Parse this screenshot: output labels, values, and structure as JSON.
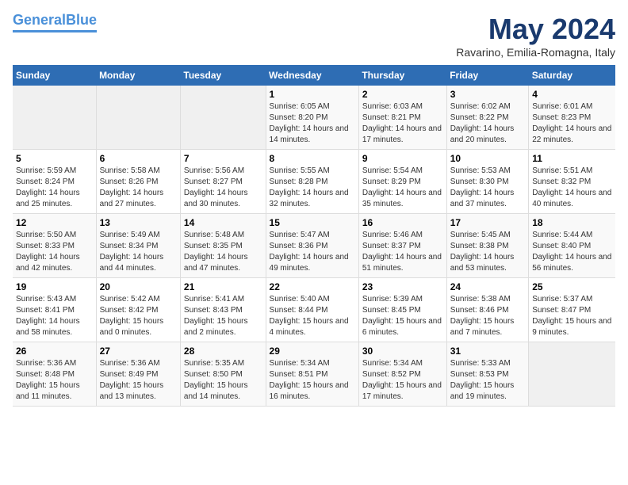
{
  "logo": {
    "line1": "General",
    "line2": "Blue"
  },
  "title": "May 2024",
  "subtitle": "Ravarino, Emilia-Romagna, Italy",
  "days_of_week": [
    "Sunday",
    "Monday",
    "Tuesday",
    "Wednesday",
    "Thursday",
    "Friday",
    "Saturday"
  ],
  "weeks": [
    [
      {
        "day": "",
        "empty": true
      },
      {
        "day": "",
        "empty": true
      },
      {
        "day": "",
        "empty": true
      },
      {
        "day": "1",
        "sunrise": "6:05 AM",
        "sunset": "8:20 PM",
        "daylight": "14 hours and 14 minutes."
      },
      {
        "day": "2",
        "sunrise": "6:03 AM",
        "sunset": "8:21 PM",
        "daylight": "14 hours and 17 minutes."
      },
      {
        "day": "3",
        "sunrise": "6:02 AM",
        "sunset": "8:22 PM",
        "daylight": "14 hours and 20 minutes."
      },
      {
        "day": "4",
        "sunrise": "6:01 AM",
        "sunset": "8:23 PM",
        "daylight": "14 hours and 22 minutes."
      }
    ],
    [
      {
        "day": "5",
        "sunrise": "5:59 AM",
        "sunset": "8:24 PM",
        "daylight": "14 hours and 25 minutes."
      },
      {
        "day": "6",
        "sunrise": "5:58 AM",
        "sunset": "8:26 PM",
        "daylight": "14 hours and 27 minutes."
      },
      {
        "day": "7",
        "sunrise": "5:56 AM",
        "sunset": "8:27 PM",
        "daylight": "14 hours and 30 minutes."
      },
      {
        "day": "8",
        "sunrise": "5:55 AM",
        "sunset": "8:28 PM",
        "daylight": "14 hours and 32 minutes."
      },
      {
        "day": "9",
        "sunrise": "5:54 AM",
        "sunset": "8:29 PM",
        "daylight": "14 hours and 35 minutes."
      },
      {
        "day": "10",
        "sunrise": "5:53 AM",
        "sunset": "8:30 PM",
        "daylight": "14 hours and 37 minutes."
      },
      {
        "day": "11",
        "sunrise": "5:51 AM",
        "sunset": "8:32 PM",
        "daylight": "14 hours and 40 minutes."
      }
    ],
    [
      {
        "day": "12",
        "sunrise": "5:50 AM",
        "sunset": "8:33 PM",
        "daylight": "14 hours and 42 minutes."
      },
      {
        "day": "13",
        "sunrise": "5:49 AM",
        "sunset": "8:34 PM",
        "daylight": "14 hours and 44 minutes."
      },
      {
        "day": "14",
        "sunrise": "5:48 AM",
        "sunset": "8:35 PM",
        "daylight": "14 hours and 47 minutes."
      },
      {
        "day": "15",
        "sunrise": "5:47 AM",
        "sunset": "8:36 PM",
        "daylight": "14 hours and 49 minutes."
      },
      {
        "day": "16",
        "sunrise": "5:46 AM",
        "sunset": "8:37 PM",
        "daylight": "14 hours and 51 minutes."
      },
      {
        "day": "17",
        "sunrise": "5:45 AM",
        "sunset": "8:38 PM",
        "daylight": "14 hours and 53 minutes."
      },
      {
        "day": "18",
        "sunrise": "5:44 AM",
        "sunset": "8:40 PM",
        "daylight": "14 hours and 56 minutes."
      }
    ],
    [
      {
        "day": "19",
        "sunrise": "5:43 AM",
        "sunset": "8:41 PM",
        "daylight": "14 hours and 58 minutes."
      },
      {
        "day": "20",
        "sunrise": "5:42 AM",
        "sunset": "8:42 PM",
        "daylight": "15 hours and 0 minutes."
      },
      {
        "day": "21",
        "sunrise": "5:41 AM",
        "sunset": "8:43 PM",
        "daylight": "15 hours and 2 minutes."
      },
      {
        "day": "22",
        "sunrise": "5:40 AM",
        "sunset": "8:44 PM",
        "daylight": "15 hours and 4 minutes."
      },
      {
        "day": "23",
        "sunrise": "5:39 AM",
        "sunset": "8:45 PM",
        "daylight": "15 hours and 6 minutes."
      },
      {
        "day": "24",
        "sunrise": "5:38 AM",
        "sunset": "8:46 PM",
        "daylight": "15 hours and 7 minutes."
      },
      {
        "day": "25",
        "sunrise": "5:37 AM",
        "sunset": "8:47 PM",
        "daylight": "15 hours and 9 minutes."
      }
    ],
    [
      {
        "day": "26",
        "sunrise": "5:36 AM",
        "sunset": "8:48 PM",
        "daylight": "15 hours and 11 minutes."
      },
      {
        "day": "27",
        "sunrise": "5:36 AM",
        "sunset": "8:49 PM",
        "daylight": "15 hours and 13 minutes."
      },
      {
        "day": "28",
        "sunrise": "5:35 AM",
        "sunset": "8:50 PM",
        "daylight": "15 hours and 14 minutes."
      },
      {
        "day": "29",
        "sunrise": "5:34 AM",
        "sunset": "8:51 PM",
        "daylight": "15 hours and 16 minutes."
      },
      {
        "day": "30",
        "sunrise": "5:34 AM",
        "sunset": "8:52 PM",
        "daylight": "15 hours and 17 minutes."
      },
      {
        "day": "31",
        "sunrise": "5:33 AM",
        "sunset": "8:53 PM",
        "daylight": "15 hours and 19 minutes."
      },
      {
        "day": "",
        "empty": true
      }
    ]
  ]
}
